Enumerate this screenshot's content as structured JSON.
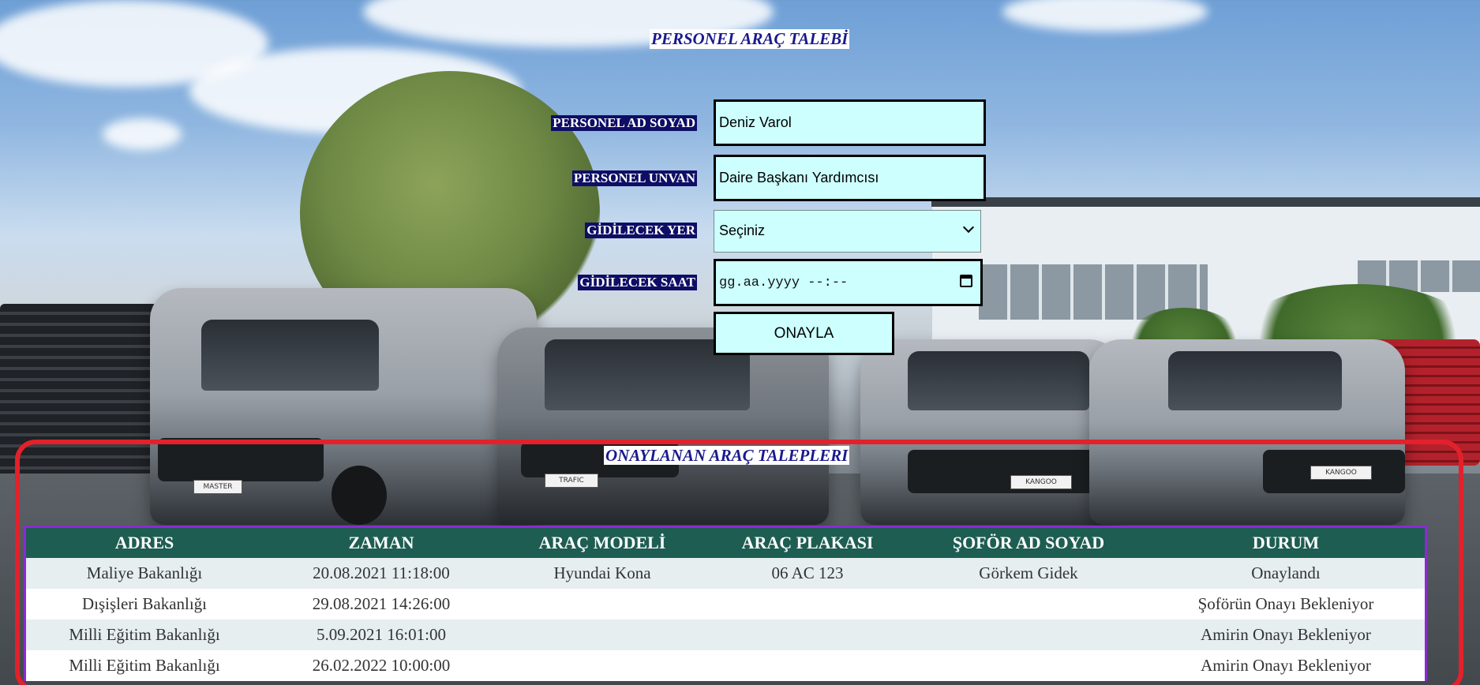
{
  "form": {
    "title": "PERSONEL ARAÇ TALEBİ",
    "name_label": "PERSONEL AD SOYAD",
    "name_value": "Deniz Varol",
    "title_label": "PERSONEL UNVAN",
    "title_value": "Daire Başkanı Yardımcısı",
    "destination_label": "GİDİLECEK YER",
    "destination_value": "Seçiniz",
    "time_label": "GİDİLECEK SAAT",
    "time_placeholder": "gg.aa.yyyy --:--",
    "confirm_label": "ONAYLA"
  },
  "approved": {
    "title": "ONAYLANAN ARAÇ TALEPLERI",
    "columns": [
      "ADRES",
      "ZAMAN",
      "ARAÇ MODELİ",
      "ARAÇ PLAKASI",
      "ŞOFÖR AD SOYAD",
      "DURUM"
    ],
    "rows": [
      [
        "Maliye Bakanlığı",
        "20.08.2021 11:18:00",
        "Hyundai Kona",
        "06 AC 123",
        "Görkem Gidek",
        "Onaylandı"
      ],
      [
        "Dışişleri Bakanlığı",
        "29.08.2021 14:26:00",
        "",
        "",
        "",
        "Şoförün Onayı Bekleniyor"
      ],
      [
        "Milli Eğitim Bakanlığı",
        "5.09.2021 16:01:00",
        "",
        "",
        "",
        "Amirin Onayı Bekleniyor"
      ],
      [
        "Milli Eğitim Bakanlığı",
        "26.02.2022 10:00:00",
        "",
        "",
        "",
        "Amirin Onayı Bekleniyor"
      ]
    ]
  },
  "background": {
    "plates": [
      "MASTER",
      "TRAFIC",
      "KANGOO",
      "KANGOO"
    ]
  },
  "colors": {
    "input_bg": "#cdfffe",
    "label_bg": "#0e0e66",
    "table_header": "#1e5d52",
    "panel_border": "#e3212b",
    "table_border": "#8a2bd0"
  }
}
